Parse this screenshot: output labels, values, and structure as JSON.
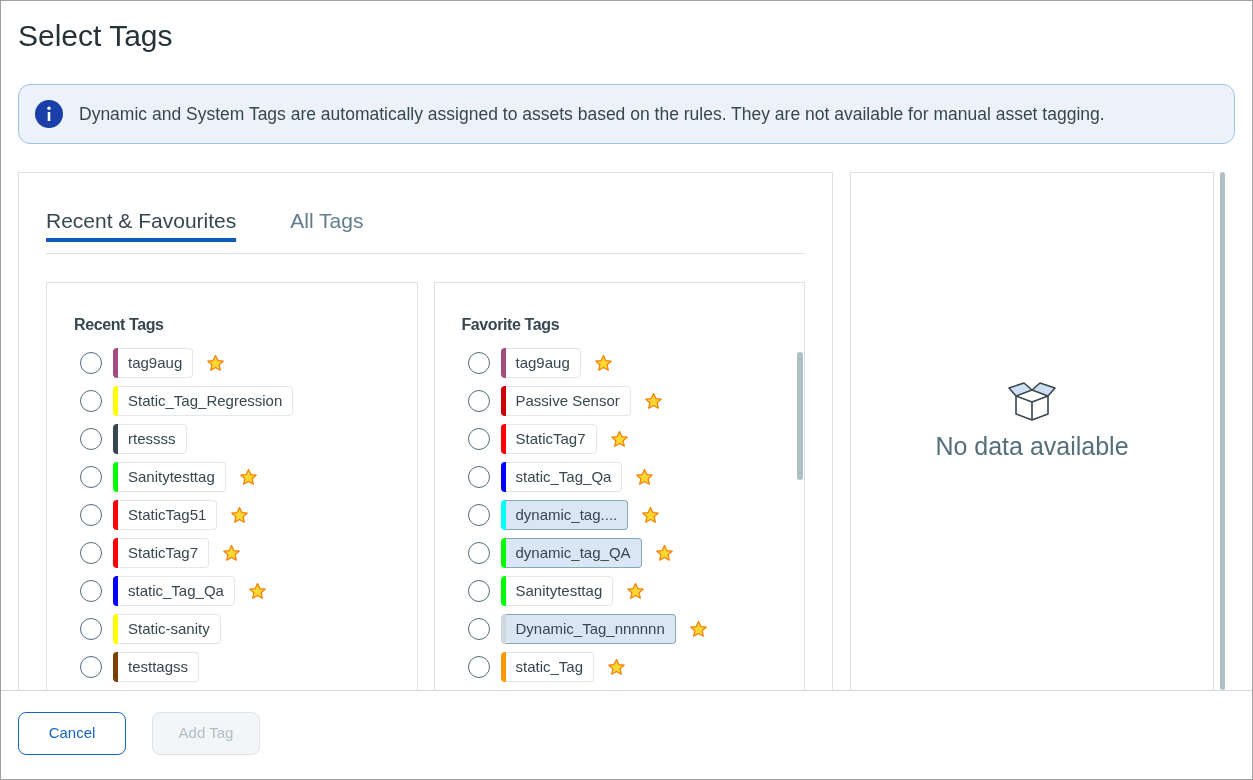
{
  "dialog": {
    "title": "Select Tags"
  },
  "info_banner": {
    "text": "Dynamic and System Tags are automatically assigned to assets based on the rules. They are not available for manual asset tagging."
  },
  "tabs": [
    {
      "label": "Recent & Favourites",
      "selected": true
    },
    {
      "label": "All Tags",
      "selected": false
    }
  ],
  "recent_tags": {
    "title": "Recent Tags",
    "items": [
      {
        "label": "tag9aug",
        "color": "#a24d7d",
        "kind": "static",
        "favorite": true,
        "selected": false
      },
      {
        "label": "Static_Tag_Regression",
        "color": "#ffff00",
        "kind": "static",
        "favorite": false,
        "selected": false
      },
      {
        "label": "rtessss",
        "color": "#37474f",
        "kind": "static",
        "favorite": false,
        "selected": false
      },
      {
        "label": "Sanitytesttag",
        "color": "#00ff00",
        "kind": "static",
        "favorite": true,
        "selected": false
      },
      {
        "label": "StaticTag51",
        "color": "#ff0000",
        "kind": "static",
        "favorite": true,
        "selected": false
      },
      {
        "label": "StaticTag7",
        "color": "#ff0000",
        "kind": "static",
        "favorite": true,
        "selected": false
      },
      {
        "label": "static_Tag_Qa",
        "color": "#0000ff",
        "kind": "static",
        "favorite": true,
        "selected": false
      },
      {
        "label": "Static-sanity",
        "color": "#ffff00",
        "kind": "static",
        "favorite": false,
        "selected": false
      },
      {
        "label": "testtagss",
        "color": "#7b3f00",
        "kind": "static",
        "favorite": false,
        "selected": false
      }
    ]
  },
  "favorite_tags": {
    "title": "Favorite Tags",
    "items": [
      {
        "label": "tag9aug",
        "color": "#a24d7d",
        "kind": "static",
        "favorite": true,
        "selected": false
      },
      {
        "label": "Passive Sensor",
        "color": "#cc0000",
        "kind": "static",
        "favorite": true,
        "selected": false
      },
      {
        "label": "StaticTag7",
        "color": "#ff0000",
        "kind": "static",
        "favorite": true,
        "selected": false
      },
      {
        "label": "static_Tag_Qa",
        "color": "#0000ff",
        "kind": "static",
        "favorite": true,
        "selected": false
      },
      {
        "label": "dynamic_tag....",
        "color": "#00ffff",
        "kind": "dynamic",
        "favorite": true,
        "selected": false
      },
      {
        "label": "dynamic_tag_QA",
        "color": "#00ff00",
        "kind": "dynamic",
        "favorite": true,
        "selected": false
      },
      {
        "label": "Sanitytesttag",
        "color": "#00ff00",
        "kind": "static",
        "favorite": true,
        "selected": false
      },
      {
        "label": "Dynamic_Tag_nnnnnn",
        "color": "#cfd8dc",
        "kind": "dynamic",
        "favorite": true,
        "selected": false
      },
      {
        "label": "static_Tag",
        "color": "#ff9800",
        "kind": "static",
        "favorite": true,
        "selected": false
      }
    ]
  },
  "preview": {
    "empty_text": "No data available"
  },
  "buttons": [
    {
      "label": "Cancel",
      "disabled": false
    },
    {
      "label": "Add Tag",
      "disabled": true
    }
  ]
}
